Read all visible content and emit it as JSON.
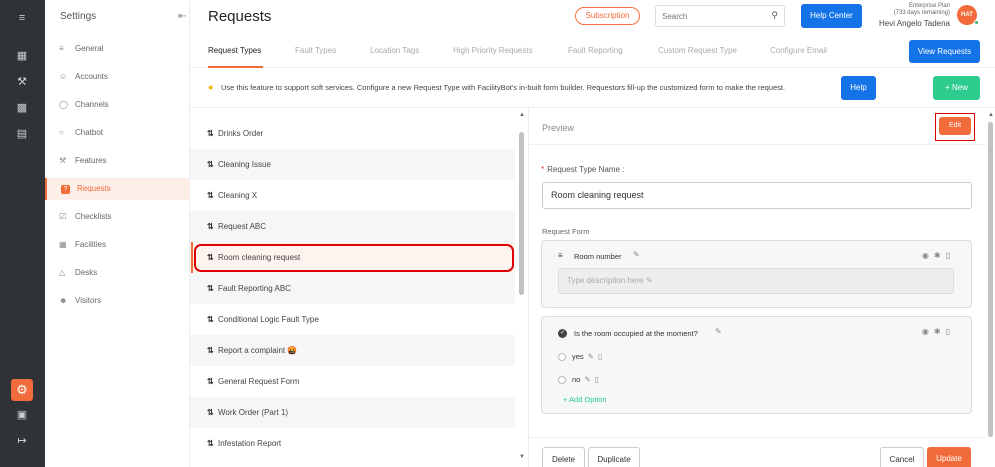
{
  "rail": {
    "icons": [
      "menu-icon",
      "dashboard-icon",
      "tools-icon",
      "chart-icon",
      "analytics-icon",
      "settings-icon",
      "box-icon",
      "logout-icon"
    ]
  },
  "sidebar": {
    "title": "Settings",
    "items": [
      {
        "label": "General",
        "icon": "sliders-icon"
      },
      {
        "label": "Accounts",
        "icon": "users-icon"
      },
      {
        "label": "Channels",
        "icon": "channels-icon"
      },
      {
        "label": "Chatbot",
        "icon": "chatbot-icon"
      },
      {
        "label": "Features",
        "icon": "features-icon"
      },
      {
        "label": "Requests",
        "icon": "requests-icon",
        "active": true
      },
      {
        "label": "Checklists",
        "icon": "checklist-icon"
      },
      {
        "label": "Facilities",
        "icon": "building-icon"
      },
      {
        "label": "Desks",
        "icon": "desk-icon"
      },
      {
        "label": "Visitors",
        "icon": "visitors-icon"
      }
    ]
  },
  "header": {
    "title": "Requests",
    "subscription_label": "Subscription",
    "search_placeholder": "Search",
    "help_center_label": "Help Center",
    "plan": "Enterprise Plan",
    "plan_remaining": "(733 days remaining)",
    "user_name": "Hevi Angelo Tadena",
    "avatar_initials": "HAT"
  },
  "tabs": [
    {
      "label": "Request Types",
      "active": true
    },
    {
      "label": "Fault Types"
    },
    {
      "label": "Location Tags"
    },
    {
      "label": "High Priority Requests"
    },
    {
      "label": "Fault Reporting"
    },
    {
      "label": "Custom Request Type"
    },
    {
      "label": "Configure Email"
    }
  ],
  "view_requests_label": "View Requests",
  "info_text": "Use this feature to support soft services. Configure a new Request Type with FacilityBot's in-built form builder. Requestors fill-up the customized form to make the request.",
  "help_label": "Help",
  "new_label": "+ New",
  "request_types": [
    "Drinks Order",
    "Cleaning Issue",
    "Cleaning X",
    "Request ABC",
    "Room cleaning request",
    "Fault Reporting ABC",
    "Conditional Logic Fault Type",
    "Report a complaint 🤬",
    "General Request Form",
    "Work Order (Part 1)",
    "Infestation Report"
  ],
  "selected_index": 4,
  "preview": {
    "title": "Preview",
    "edit_label": "Edit",
    "type_name_label": "Request Type Name :",
    "type_name_value": "Room cleaning request",
    "request_form_label": "Request Form",
    "field1": {
      "title": "Room number",
      "description_placeholder": "Type description here"
    },
    "field2": {
      "question": "Is the room occupied at the moment?",
      "options": [
        "yes",
        "no"
      ],
      "add_option_label": "+ Add Option"
    },
    "delete_label": "Delete",
    "duplicate_label": "Duplicate",
    "cancel_label": "Cancel",
    "update_label": "Update"
  },
  "colors": {
    "accent": "#f26b3a",
    "primary": "#1473e6",
    "success": "#2ecc8f",
    "rail": "#2f3236"
  }
}
